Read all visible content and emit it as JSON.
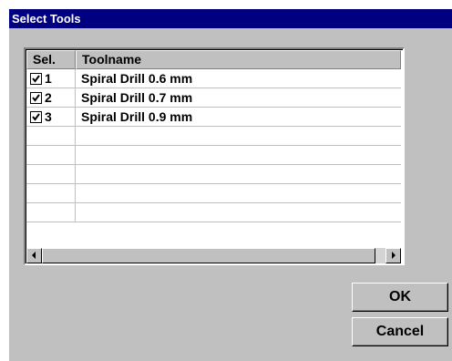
{
  "window": {
    "title": "Select Tools"
  },
  "table": {
    "columns": [
      "Sel.",
      "Toolname"
    ],
    "rows": [
      {
        "checked": true,
        "num": "1",
        "name": "Spiral Drill 0.6 mm"
      },
      {
        "checked": true,
        "num": "2",
        "name": "Spiral Drill 0.7 mm"
      },
      {
        "checked": true,
        "num": "3",
        "name": "Spiral Drill 0.9 mm"
      },
      {
        "checked": false,
        "num": "",
        "name": ""
      },
      {
        "checked": false,
        "num": "",
        "name": ""
      },
      {
        "checked": false,
        "num": "",
        "name": ""
      },
      {
        "checked": false,
        "num": "",
        "name": ""
      },
      {
        "checked": false,
        "num": "",
        "name": ""
      }
    ]
  },
  "buttons": {
    "ok": "OK",
    "cancel": "Cancel"
  },
  "icons": {
    "scroll_left": "scroll-left-arrow-icon",
    "scroll_right": "scroll-right-arrow-icon",
    "check": "checkbox-check-icon"
  },
  "colors": {
    "titlebar": "#000080",
    "face": "#c0c0c0"
  }
}
